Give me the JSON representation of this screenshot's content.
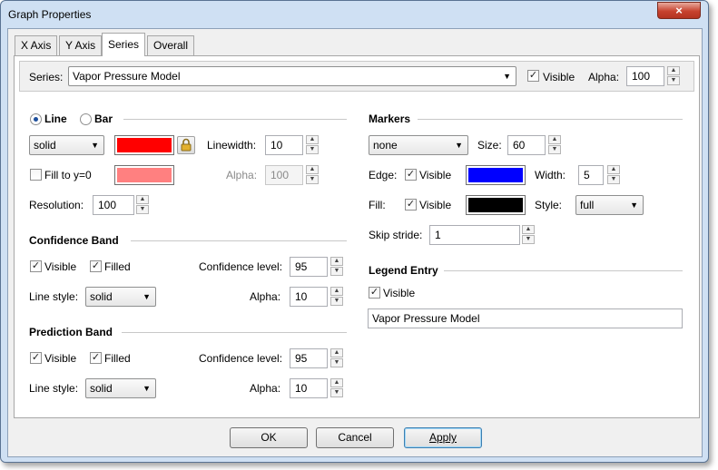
{
  "window": {
    "title": "Graph Properties",
    "close_glyph": "×"
  },
  "tabs": [
    {
      "label": "X Axis"
    },
    {
      "label": "Y Axis"
    },
    {
      "label": "Series"
    },
    {
      "label": "Overall"
    }
  ],
  "series_bar": {
    "label": "Series:",
    "selected": "Vapor Pressure Model",
    "visible_label": "Visible",
    "visible_checked": true,
    "alpha_label": "Alpha:",
    "alpha_value": "100"
  },
  "line_section": {
    "line_label": "Line",
    "bar_label": "Bar",
    "style": "solid",
    "line_color": "#ff0000",
    "linewidth_label": "Linewidth:",
    "linewidth_value": "10",
    "fill_label": "Fill to y=0",
    "fill_color": "#ff8080",
    "alpha_label": "Alpha:",
    "alpha_value": "100",
    "resolution_label": "Resolution:",
    "resolution_value": "100"
  },
  "confidence_band": {
    "title": "Confidence Band",
    "visible_label": "Visible",
    "filled_label": "Filled",
    "level_label": "Confidence level:",
    "level_value": "95",
    "linestyle_label": "Line style:",
    "linestyle_value": "solid",
    "alpha_label": "Alpha:",
    "alpha_value": "10"
  },
  "prediction_band": {
    "title": "Prediction Band",
    "visible_label": "Visible",
    "filled_label": "Filled",
    "level_label": "Confidence level:",
    "level_value": "95",
    "linestyle_label": "Line style:",
    "linestyle_value": "solid",
    "alpha_label": "Alpha:",
    "alpha_value": "10"
  },
  "markers": {
    "title": "Markers",
    "shape": "none",
    "size_label": "Size:",
    "size_value": "60",
    "edge_label": "Edge:",
    "edge_visible_label": "Visible",
    "edge_color": "#0000ff",
    "width_label": "Width:",
    "width_value": "5",
    "fill_label": "Fill:",
    "fill_visible_label": "Visible",
    "fill_color": "#000000",
    "style_label": "Style:",
    "style_value": "full",
    "skip_label": "Skip stride:",
    "skip_value": "1"
  },
  "legend": {
    "title": "Legend Entry",
    "visible_label": "Visible",
    "text": "Vapor Pressure Model"
  },
  "buttons": {
    "ok": "OK",
    "cancel": "Cancel",
    "apply": "Apply"
  },
  "glyphs": {
    "check": "✓",
    "combo_arrow": "▼",
    "spin_up": "▲",
    "spin_down": "▼"
  }
}
